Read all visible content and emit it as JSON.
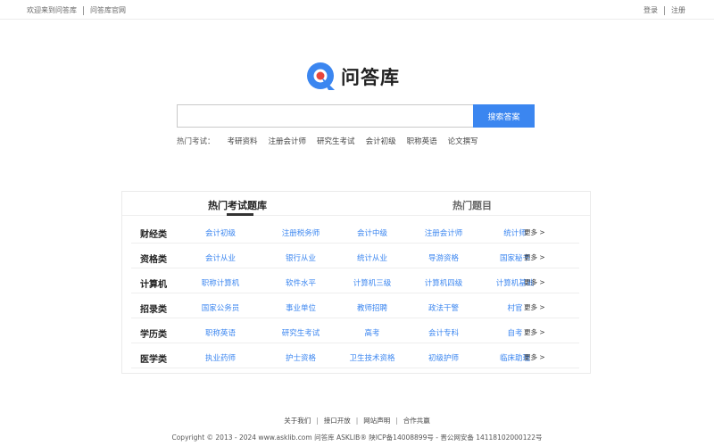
{
  "topbar": {
    "welcome": "欢迎来到问答库",
    "official": "问答库官网",
    "login": "登录",
    "register": "注册"
  },
  "logo": {
    "text": "问答库",
    "brand_blue": "#3b86f0",
    "brand_red": "#e8453c"
  },
  "search": {
    "value": "",
    "placeholder": "",
    "button": "搜索答案"
  },
  "hot": {
    "label": "热门考试：",
    "items": [
      "考研资料",
      "注册会计师",
      "研究生考试",
      "会计初级",
      "职称英语",
      "论文撰写"
    ]
  },
  "tabs": [
    "热门考试题库",
    "热门题目"
  ],
  "more_label": "更多 >",
  "categories": [
    {
      "name": "财经类",
      "items": [
        "会计初级",
        "注册税务师",
        "会计中级",
        "注册会计师",
        "统计师"
      ]
    },
    {
      "name": "资格类",
      "items": [
        "会计从业",
        "银行从业",
        "统计从业",
        "导游资格",
        "国家秘书"
      ]
    },
    {
      "name": "计算机",
      "items": [
        "职称计算机",
        "软件水平",
        "计算机三级",
        "计算机四级",
        "计算机基础"
      ]
    },
    {
      "name": "招录类",
      "items": [
        "国家公务员",
        "事业单位",
        "教师招聘",
        "政法干警",
        "村官"
      ]
    },
    {
      "name": "学历类",
      "items": [
        "职称英语",
        "研究生考试",
        "高考",
        "会计专科",
        "自考"
      ]
    },
    {
      "name": "医学类",
      "items": [
        "执业药师",
        "护士资格",
        "卫生技术资格",
        "初级护师",
        "临床助理"
      ]
    }
  ],
  "footer": {
    "links": [
      "关于我们",
      "接口开放",
      "网站声明",
      "合作共赢"
    ],
    "copyright": "Copyright © 2013 - 2024 www.asklib.com  问答库  ASKLIB® 陕ICP备14008899号 - 晋公网安备 14118102000122号"
  }
}
